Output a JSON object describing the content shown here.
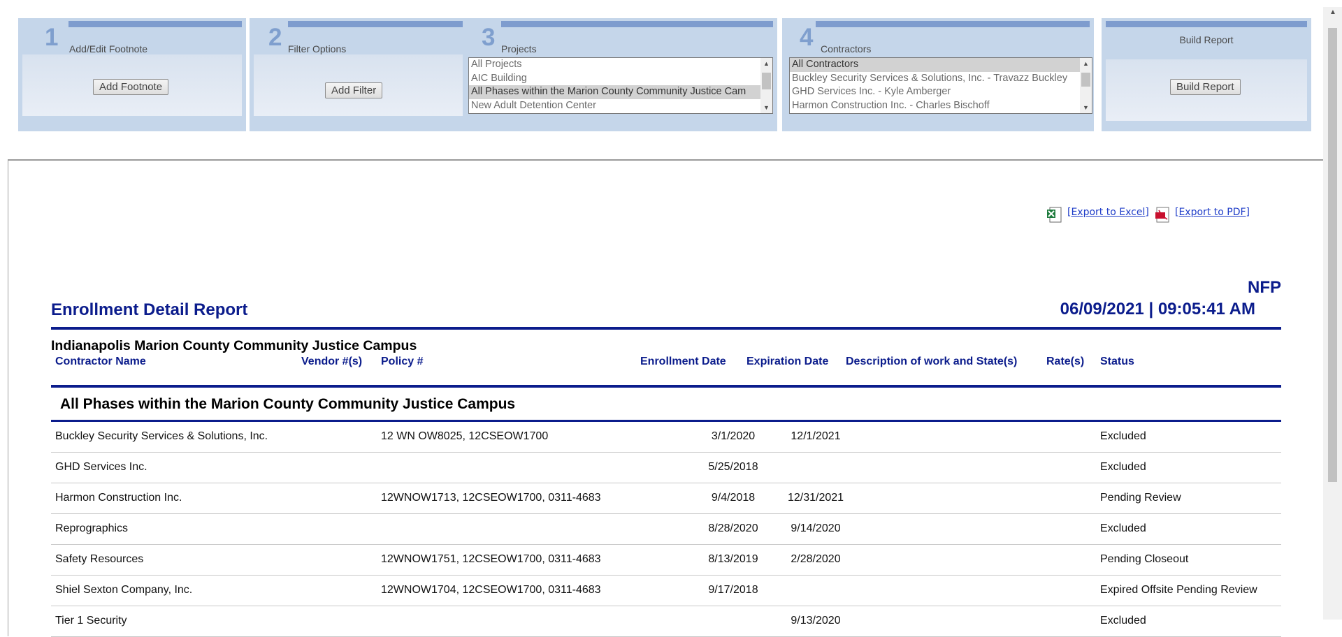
{
  "steps": [
    {
      "num": "1",
      "title": "Add/Edit Footnote",
      "button": "Add Footnote"
    },
    {
      "num": "2",
      "title": "Filter Options",
      "button": "Add Filter"
    },
    {
      "num": "3",
      "title": "Projects"
    },
    {
      "num": "4",
      "title": "Contractors"
    },
    {
      "title": "Build Report",
      "button": "Build Report"
    }
  ],
  "projects_list": {
    "options": [
      "All Projects",
      "AIC Building",
      "All Phases within the Marion County Community Justice Cam",
      "New Adult Detention Center"
    ],
    "selected": "All Phases within the Marion County Community Justice Cam"
  },
  "contractors_list": {
    "options": [
      "All Contractors",
      "Buckley Security Services & Solutions, Inc. - Travazz Buckley",
      "GHD Services Inc. - Kyle Amberger",
      "Harmon Construction Inc. - Charles Bischoff"
    ],
    "selected": "All Contractors"
  },
  "export": {
    "excel": "[Export to Excel]",
    "pdf": "[Export to PDF]"
  },
  "report": {
    "title": "Enrollment Detail Report",
    "org": "NFP",
    "datetime": "06/09/2021 | 09:05:41 AM",
    "campus": "Indianapolis Marion County Community Justice Campus",
    "phase": "All Phases within the Marion County Community Justice Campus"
  },
  "columns": [
    "Contractor Name",
    "Vendor #(s)",
    "Policy #",
    "Enrollment Date",
    "Expiration Date",
    "Description of work and State(s)",
    "Rate(s)",
    "Status"
  ],
  "rows": [
    {
      "name": "Buckley Security Services & Solutions, Inc.",
      "vendor": "",
      "policy": "12 WN OW8025, 12CSEOW1700",
      "enroll": "3/1/2020",
      "expire": "12/1/2021",
      "desc": "",
      "rate": "",
      "status": "Excluded"
    },
    {
      "name": "GHD Services Inc.",
      "vendor": "",
      "policy": "",
      "enroll": "5/25/2018",
      "expire": "",
      "desc": "",
      "rate": "",
      "status": "Excluded"
    },
    {
      "name": "Harmon Construction Inc.",
      "vendor": "",
      "policy": "12WNOW1713, 12CSEOW1700, 0311-4683",
      "enroll": "9/4/2018",
      "expire": "12/31/2021",
      "desc": "",
      "rate": "",
      "status": "Pending Review"
    },
    {
      "name": "Reprographics",
      "vendor": "",
      "policy": "",
      "enroll": "8/28/2020",
      "expire": "9/14/2020",
      "desc": "",
      "rate": "",
      "status": "Excluded"
    },
    {
      "name": "Safety Resources",
      "vendor": "",
      "policy": "12WNOW1751, 12CSEOW1700, 0311-4683",
      "enroll": "8/13/2019",
      "expire": "2/28/2020",
      "desc": "",
      "rate": "",
      "status": "Pending Closeout"
    },
    {
      "name": "Shiel Sexton Company, Inc.",
      "vendor": "",
      "policy": "12WNOW1704, 12CSEOW1700, 0311-4683",
      "enroll": "9/17/2018",
      "expire": "",
      "desc": "",
      "rate": "",
      "status": "Expired Offsite Pending Review"
    },
    {
      "name": "Tier 1 Security",
      "vendor": "",
      "policy": "",
      "enroll": "",
      "expire": "9/13/2020",
      "desc": "",
      "rate": "",
      "status": "Excluded"
    }
  ],
  "colors": {
    "navy": "#0b1c8c",
    "panel": "#c5d6ea",
    "panel_header": "#7e9cce"
  }
}
